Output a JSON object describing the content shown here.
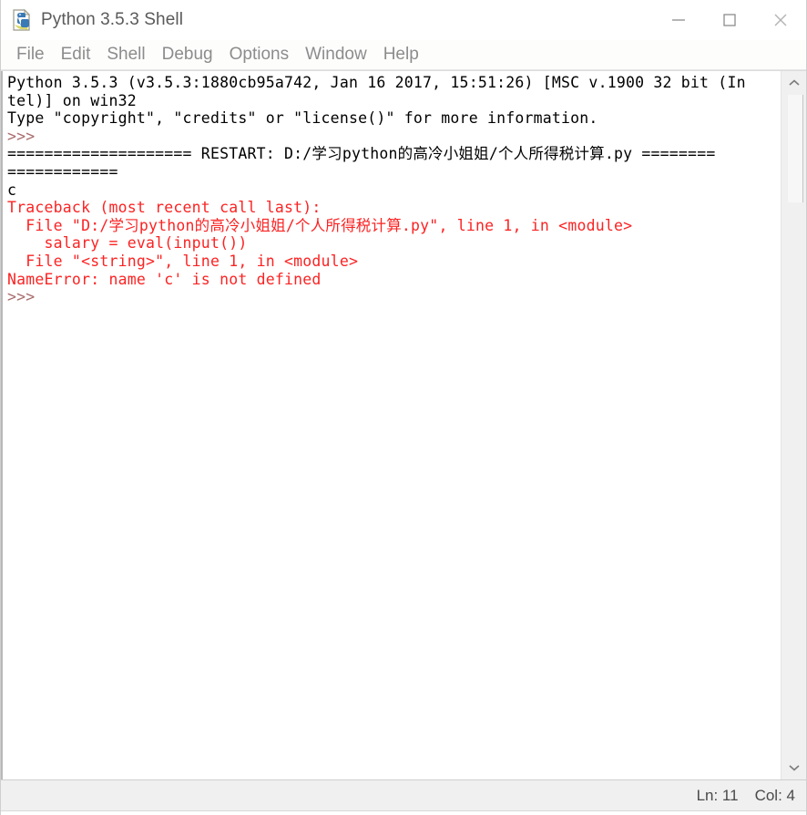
{
  "window": {
    "title": "Python 3.5.3 Shell",
    "icon": "python-idle-document-icon",
    "controls": {
      "minimize": "minimize-icon",
      "maximize": "maximize-icon",
      "close": "close-icon"
    }
  },
  "menubar": {
    "items": [
      {
        "label": "File"
      },
      {
        "label": "Edit"
      },
      {
        "label": "Shell"
      },
      {
        "label": "Debug"
      },
      {
        "label": "Options"
      },
      {
        "label": "Window"
      },
      {
        "label": "Help"
      }
    ]
  },
  "console": {
    "lines": [
      {
        "color": "black",
        "text": "Python 3.5.3 (v3.5.3:1880cb95a742, Jan 16 2017, 15:51:26) [MSC v.1900 32 bit (In"
      },
      {
        "color": "black",
        "text": "tel)] on win32"
      },
      {
        "color": "black",
        "text": "Type \"copyright\", \"credits\" or \"license()\" for more information."
      },
      {
        "color": "prompt",
        "text": ">>> "
      },
      {
        "color": "black",
        "text": "==================== RESTART: D:/学习python的高冷小姐姐/个人所得税计算.py ========"
      },
      {
        "color": "black",
        "text": "============"
      },
      {
        "color": "black",
        "text": "c"
      },
      {
        "color": "red",
        "text": "Traceback (most recent call last):"
      },
      {
        "color": "red",
        "text": "  File \"D:/学习python的高冷小姐姐/个人所得税计算.py\", line 1, in <module>"
      },
      {
        "color": "red",
        "text": "    salary = eval(input())"
      },
      {
        "color": "red",
        "text": "  File \"<string>\", line 1, in <module>"
      },
      {
        "color": "red",
        "text": "NameError: name 'c' is not defined"
      },
      {
        "color": "prompt",
        "text": ">>> "
      }
    ]
  },
  "scrollbar": {
    "up_arrow": "chevron-up-icon",
    "down_arrow": "chevron-down-icon"
  },
  "statusbar": {
    "line_label": "Ln: 11",
    "col_label": "Col: 4"
  },
  "colors": {
    "error_red": "#fb2323",
    "prompt_maroon": "#a96b6b",
    "chrome_gray": "#f0f0f0",
    "menu_text": "#8c8c8c"
  }
}
